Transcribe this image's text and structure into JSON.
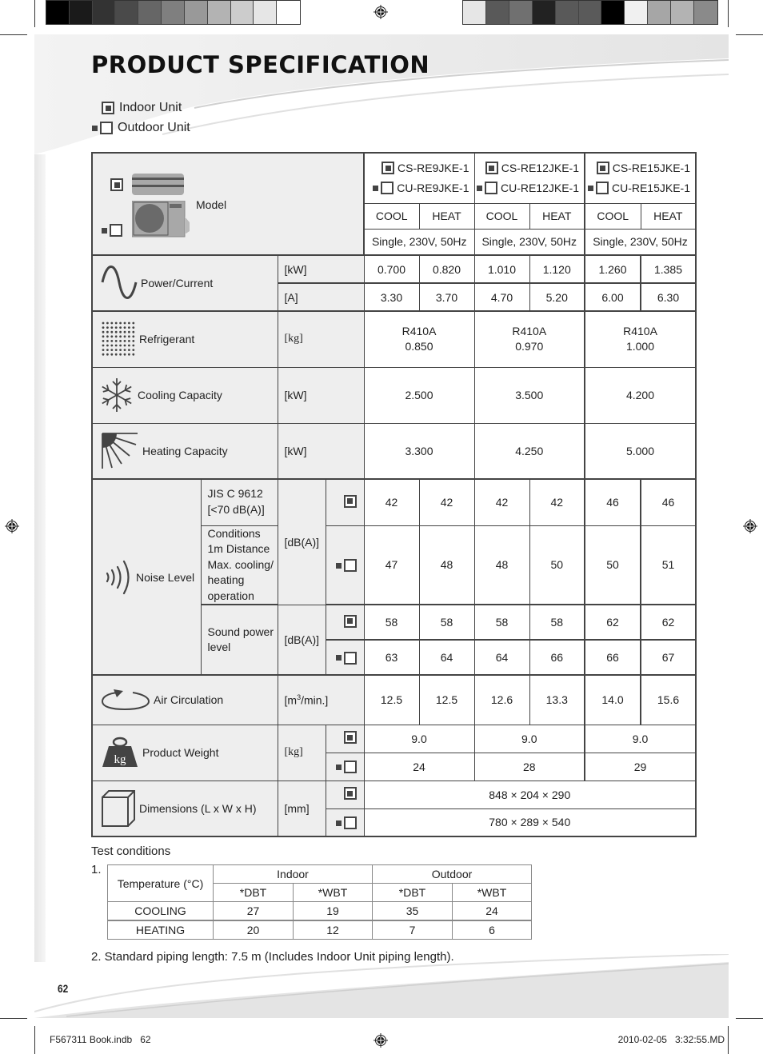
{
  "page": {
    "title": "PRODUCT SPECIFICATION",
    "page_number": "62",
    "colors": {
      "text": "#222222",
      "label_bg": "#eeeeee",
      "border": "#444444",
      "marker": "#444444"
    }
  },
  "legend": {
    "indoor_label": "Indoor Unit",
    "outdoor_label": "Outdoor Unit",
    "indoor_icon": "filled-square-marker-icon",
    "outdoor_icon": "dot-and-empty-square-marker-icon"
  },
  "spec": {
    "model_label": "Model",
    "models": [
      {
        "indoor": "CS-RE9JKE-1",
        "outdoor": "CU-RE9JKE-1"
      },
      {
        "indoor": "CS-RE12JKE-1",
        "outdoor": "CU-RE12JKE-1"
      },
      {
        "indoor": "CS-RE15JKE-1",
        "outdoor": "CU-RE15JKE-1"
      }
    ],
    "modes": [
      "COOL",
      "HEAT",
      "COOL",
      "HEAT",
      "COOL",
      "HEAT"
    ],
    "power_supply": [
      "Single, 230V, 50Hz",
      "Single, 230V, 50Hz",
      "Single, 230V, 50Hz"
    ],
    "power_current": {
      "label": "Power/Current",
      "icon": "sine-wave-icon",
      "kw_unit": "[kW]",
      "kw": [
        "0.700",
        "0.820",
        "1.010",
        "1.120",
        "1.260",
        "1.385"
      ],
      "a_unit": "[A]",
      "a": [
        "3.30",
        "3.70",
        "4.70",
        "5.20",
        "6.00",
        "6.30"
      ]
    },
    "refrigerant": {
      "label": "Refrigerant",
      "icon": "dot-grid-icon",
      "unit": "[kg]",
      "values": [
        {
          "type": "R410A",
          "amount": "0.850"
        },
        {
          "type": "R410A",
          "amount": "0.970"
        },
        {
          "type": "R410A",
          "amount": "1.000"
        }
      ]
    },
    "cooling_capacity": {
      "label": "Cooling Capacity",
      "icon": "snowflake-icon",
      "unit": "[kW]",
      "values": [
        "2.500",
        "3.500",
        "4.200"
      ]
    },
    "heating_capacity": {
      "label": "Heating Capacity",
      "icon": "sun-rays-icon",
      "unit": "[kW]",
      "values": [
        "3.300",
        "4.250",
        "5.000"
      ]
    },
    "noise_level": {
      "label": "Noise Level",
      "icon": "sound-waves-icon",
      "jis_label": "JIS C 9612 [<70 dB(A)]",
      "jis_line1": "JIS C 9612",
      "jis_line2": "[<70 dB(A)]",
      "conditions_lines": [
        "Conditions",
        "1m Distance",
        "Max. cooling/",
        "heating",
        "operation"
      ],
      "unit": "[dB(A)]",
      "indoor": [
        "42",
        "42",
        "42",
        "42",
        "46",
        "46"
      ],
      "outdoor": [
        "47",
        "48",
        "48",
        "50",
        "50",
        "51"
      ],
      "sound_power_line1": "Sound power",
      "sound_power_line2": "level",
      "sound_power_unit": "[dB(A)]",
      "sound_power_indoor": [
        "58",
        "58",
        "58",
        "58",
        "62",
        "62"
      ],
      "sound_power_outdoor": [
        "63",
        "64",
        "64",
        "66",
        "66",
        "67"
      ]
    },
    "air_circulation": {
      "label": "Air Circulation",
      "icon": "circular-arrow-icon",
      "unit_base": "[m",
      "unit_sup": "3",
      "unit_rest": "/min.]",
      "values": [
        "12.5",
        "12.5",
        "12.6",
        "13.3",
        "14.0",
        "15.6"
      ]
    },
    "product_weight": {
      "label": "Product Weight",
      "icon": "kg-weight-icon",
      "unit": "[kg]",
      "indoor": [
        "9.0",
        "9.0",
        "9.0"
      ],
      "outdoor": [
        "24",
        "28",
        "29"
      ]
    },
    "dimensions": {
      "label": "Dimensions (L x W x H)",
      "icon": "box-icon",
      "unit": "[mm]",
      "indoor": "848 × 204 × 290",
      "outdoor": "780 × 289 × 540"
    }
  },
  "test_conditions": {
    "heading": "Test conditions",
    "item1_number": "1.",
    "header_temp": "Temperature (°C)",
    "header_indoor": "Indoor",
    "header_outdoor": "Outdoor",
    "sub_headers": [
      "*DBT",
      "*WBT",
      "*DBT",
      "*WBT"
    ],
    "rows": [
      {
        "label": "COOLING",
        "values": [
          "27",
          "19",
          "35",
          "24"
        ]
      },
      {
        "label": "HEATING",
        "values": [
          "20",
          "12",
          "7",
          "6"
        ]
      }
    ],
    "item2": "2. Standard piping length: 7.5 m (Includes Indoor Unit piping length)."
  },
  "footer": {
    "file": "F567311 Book.indb   62",
    "timestamp": "2010-02-05   3:32:55.MD"
  }
}
